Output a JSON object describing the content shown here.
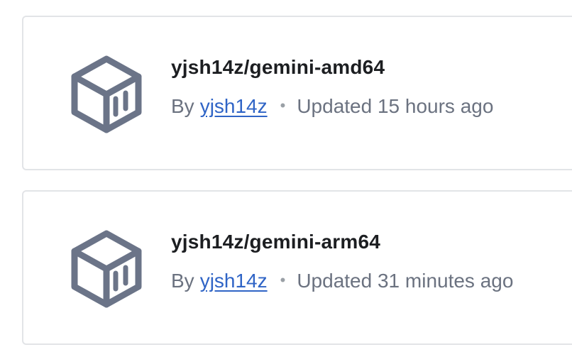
{
  "colors": {
    "icon": "#6b7488",
    "link": "#2f64c6",
    "title": "#1c1e21",
    "meta": "#6b7280",
    "border": "#e2e4e7"
  },
  "repos": [
    {
      "name": "yjsh14z/gemini-amd64",
      "by_label": "By",
      "author": "yjsh14z",
      "separator": "•",
      "updated": "Updated 15 hours ago",
      "icon": "cube-icon"
    },
    {
      "name": "yjsh14z/gemini-arm64",
      "by_label": "By",
      "author": "yjsh14z",
      "separator": "•",
      "updated": "Updated 31 minutes ago",
      "icon": "cube-icon"
    }
  ]
}
